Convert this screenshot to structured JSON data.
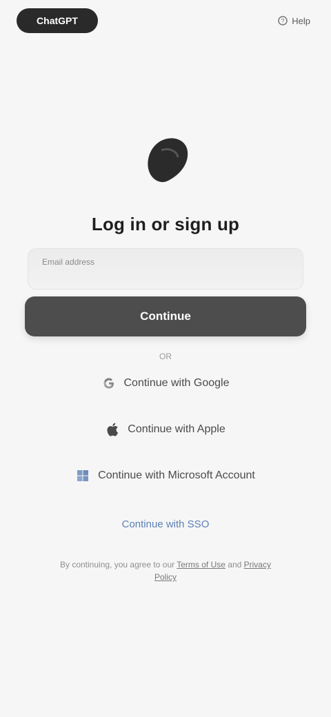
{
  "header": {
    "app_button_label": "ChatGPT",
    "help_link_label": "Help"
  },
  "logo": {
    "icon": "openai-logo-icon"
  },
  "main": {
    "title": "Log in or sign up",
    "email": {
      "label": "Email address",
      "value": "",
      "placeholder": ""
    },
    "continue_label": "Continue",
    "divider_label": "OR"
  },
  "social": {
    "google_label": "Continue with Google",
    "apple_label": "Continue with Apple",
    "microsoft_label": "Continue with Microsoft Account"
  },
  "sso_label": "Continue with SSO",
  "legal": {
    "prefix": "By continuing, you agree to our",
    "terms": "Terms of Use",
    "and": "and",
    "privacy": "Privacy Policy"
  },
  "colors": {
    "background": "#f6f6f6",
    "primary_button": "#4d4d4d",
    "link": "#5b7fb6"
  }
}
